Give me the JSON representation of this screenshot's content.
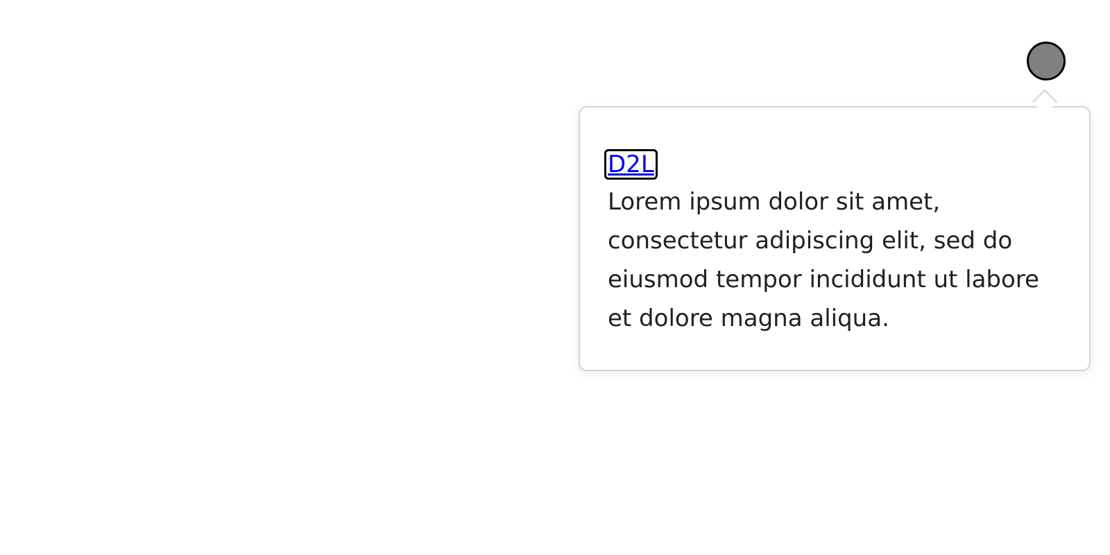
{
  "opener": {
    "color": "#808080",
    "icon": "circle-icon"
  },
  "popover": {
    "link_text": "D2L",
    "body_text": "Lorem ipsum dolor sit amet, consectetur adipiscing elit, sed do eiusmod tempor incididunt ut labore et dolore magna aliqua."
  },
  "colors": {
    "link": "#0000ee",
    "text": "#202122",
    "border": "#cdd5dc",
    "background": "#ffffff"
  }
}
